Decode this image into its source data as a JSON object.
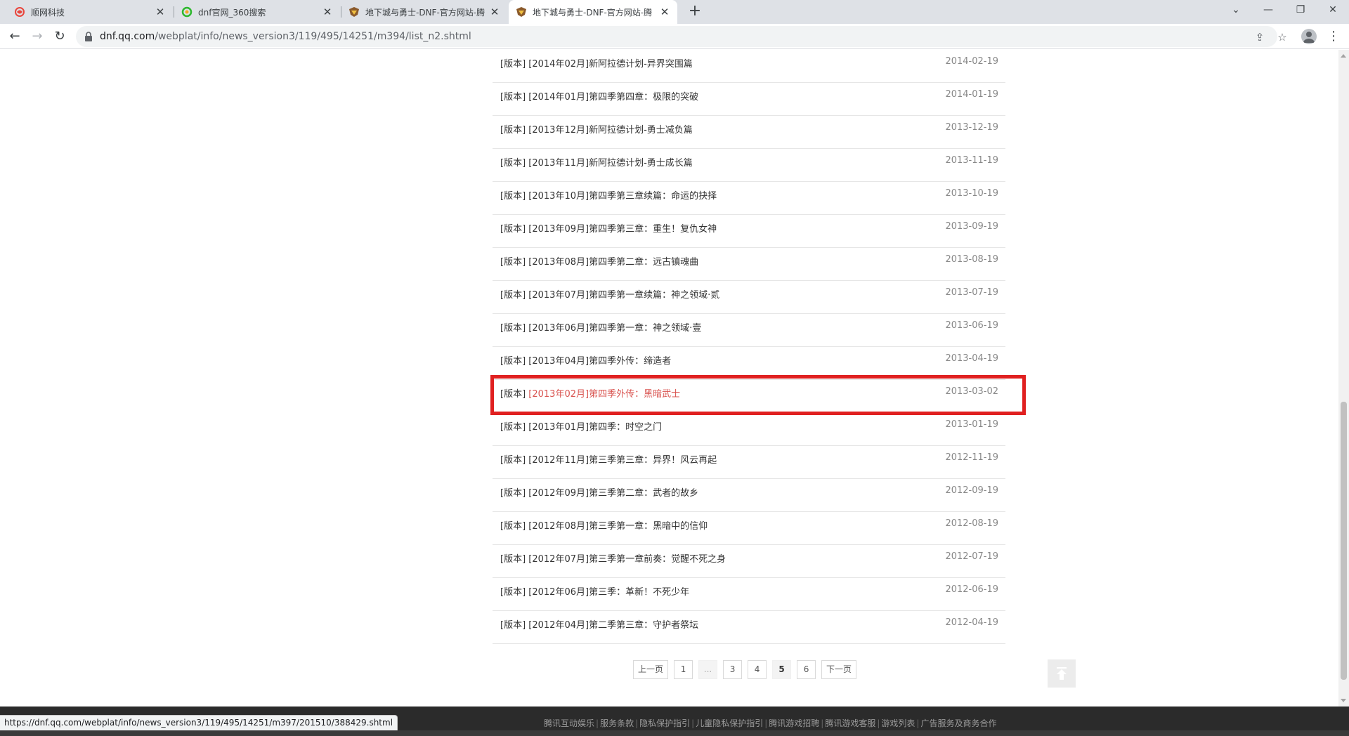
{
  "tabs": [
    {
      "title": "顺网科技",
      "active": false
    },
    {
      "title": "dnf官网_360搜索",
      "active": false
    },
    {
      "title": "地下城与勇士-DNF-官方网站-腾",
      "active": false
    },
    {
      "title": "地下城与勇士-DNF-官方网站-腾",
      "active": true
    }
  ],
  "address_bar": {
    "host": "dnf.qq.com",
    "path": "/webplat/info/news_version3/119/495/14251/m394/list_n2.shtml"
  },
  "news": [
    {
      "category": "[版本]",
      "title": "[2014年02月]新阿拉德计划-异界突围篇",
      "date": "2014-02-19"
    },
    {
      "category": "[版本]",
      "title": "[2014年01月]第四季第四章：极限的突破",
      "date": "2014-01-19"
    },
    {
      "category": "[版本]",
      "title": "[2013年12月]新阿拉德计划-勇士减负篇",
      "date": "2013-12-19"
    },
    {
      "category": "[版本]",
      "title": "[2013年11月]新阿拉德计划-勇士成长篇",
      "date": "2013-11-19"
    },
    {
      "category": "[版本]",
      "title": "[2013年10月]第四季第三章续篇：命运的抉择",
      "date": "2013-10-19"
    },
    {
      "category": "[版本]",
      "title": "[2013年09月]第四季第三章：重生！复仇女神",
      "date": "2013-09-19"
    },
    {
      "category": "[版本]",
      "title": "[2013年08月]第四季第二章：远古镇魂曲",
      "date": "2013-08-19"
    },
    {
      "category": "[版本]",
      "title": "[2013年07月]第四季第一章续篇：神之领域·贰",
      "date": "2013-07-19"
    },
    {
      "category": "[版本]",
      "title": "[2013年06月]第四季第一章：神之领域·壹",
      "date": "2013-06-19"
    },
    {
      "category": "[版本]",
      "title": "[2013年04月]第四季外传：缔造者",
      "date": "2013-04-19"
    },
    {
      "category": "[版本]",
      "title": "[2013年02月]第四季外传：黑暗武士",
      "date": "2013-03-02",
      "highlighted": true
    },
    {
      "category": "[版本]",
      "title": "[2013年01月]第四季：时空之门",
      "date": "2013-01-19"
    },
    {
      "category": "[版本]",
      "title": "[2012年11月]第三季第三章：异界！风云再起",
      "date": "2012-11-19"
    },
    {
      "category": "[版本]",
      "title": "[2012年09月]第三季第二章：武者的故乡",
      "date": "2012-09-19"
    },
    {
      "category": "[版本]",
      "title": "[2012年08月]第三季第一章：黑暗中的信仰",
      "date": "2012-08-19"
    },
    {
      "category": "[版本]",
      "title": "[2012年07月]第三季第一章前奏：觉醒不死之身",
      "date": "2012-07-19"
    },
    {
      "category": "[版本]",
      "title": "[2012年06月]第三季：革新！不死少年",
      "date": "2012-06-19"
    },
    {
      "category": "[版本]",
      "title": "[2012年04月]第二季第三章：守护者祭坛",
      "date": "2012-04-19"
    }
  ],
  "pagination": {
    "prev": "上一页",
    "first": "1",
    "ellipsis": "...",
    "p3": "3",
    "p4": "4",
    "current": "5",
    "p6": "6",
    "next": "下一页"
  },
  "footer": {
    "links": [
      "腾讯互动娱乐",
      "服务条款",
      "隐私保护指引",
      "儿童隐私保护指引",
      "腾讯游戏招聘",
      "腾讯游戏客服",
      "游戏列表",
      "广告服务及商务合作"
    ]
  },
  "status_url": "https://dnf.qq.com/webplat/info/news_version3/119/495/14251/m397/201510/388429.shtml",
  "colors": {
    "highlight_border": "#e02020",
    "highlight_text": "#d9534f"
  }
}
